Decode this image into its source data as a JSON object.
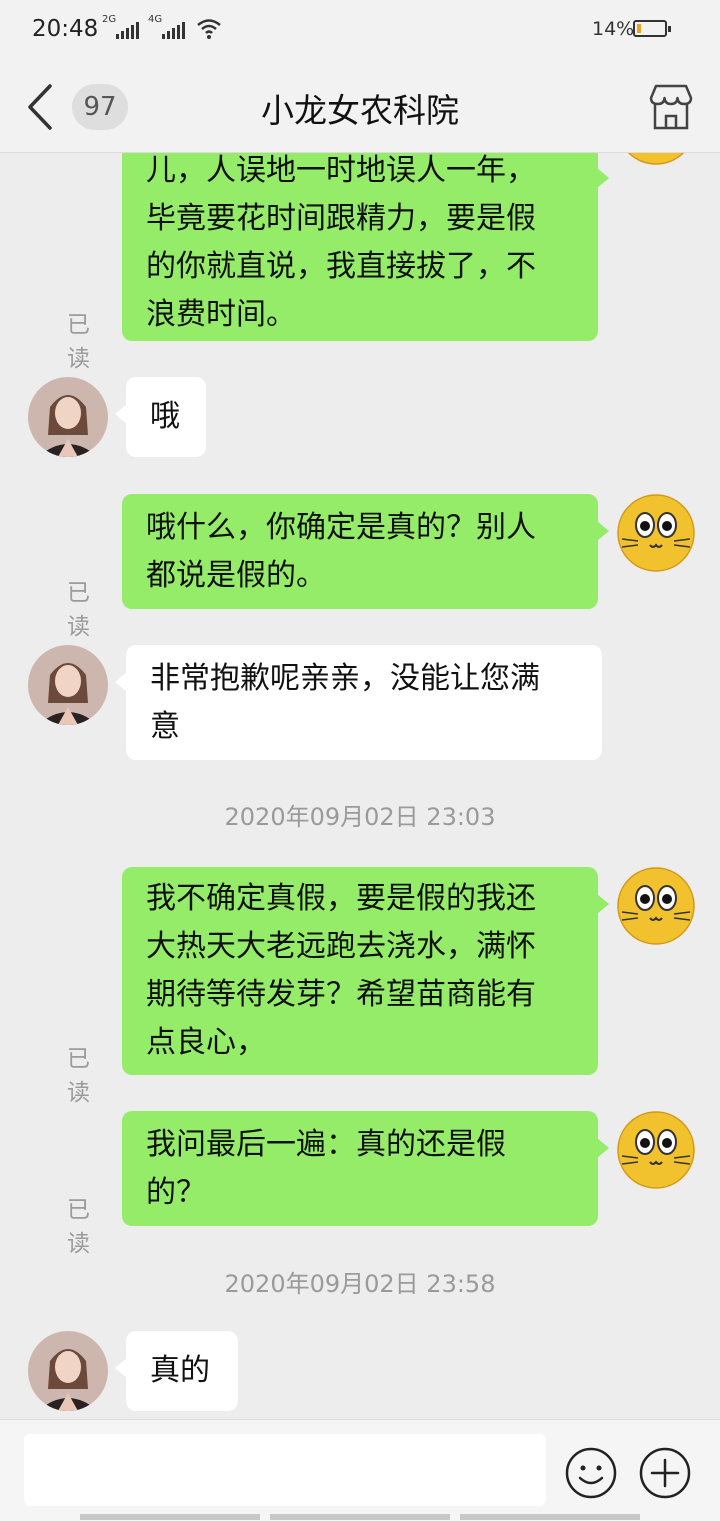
{
  "status_bar": {
    "time": "20:48",
    "network1": "2G",
    "network2": "4G",
    "battery_pct": "14%",
    "battery_level": 0.14
  },
  "header": {
    "unread_count": "97",
    "title": "小龙女农科院"
  },
  "messages": [
    {
      "dir": "out",
      "text": "儿，人误地一时地误人一年，\n毕竟要花时间跟精力，要是假\n的你就直说，我直接拔了，不\n浪费时间。",
      "read_label": "已读"
    },
    {
      "dir": "in",
      "text": "哦"
    },
    {
      "dir": "out",
      "text": "哦什么，你确定是真的？别人\n都说是假的。",
      "read_label": "已读"
    },
    {
      "dir": "in",
      "text": "非常抱歉呢亲亲，没能让您满\n意"
    },
    {
      "timestamp": "2020年09月02日 23:03"
    },
    {
      "dir": "out",
      "text": "我不确定真假，要是假的我还\n大热天大老远跑去浇水，满怀\n期待等待发芽？希望苗商能有\n点良心，",
      "read_label": "已读"
    },
    {
      "dir": "out",
      "text": "我问最后一遍：真的还是假\n的？",
      "read_label": "已读"
    },
    {
      "timestamp": "2020年09月02日 23:58"
    },
    {
      "dir": "in",
      "text": "真的"
    }
  ],
  "icons": {
    "back": "chevron-left-icon",
    "shop": "store-icon",
    "emoji": "smiley-icon",
    "plus": "plus-circle-icon"
  },
  "colors": {
    "outgoing_bubble": "#95ec69",
    "incoming_bubble": "#ffffff",
    "background": "#ededed"
  }
}
